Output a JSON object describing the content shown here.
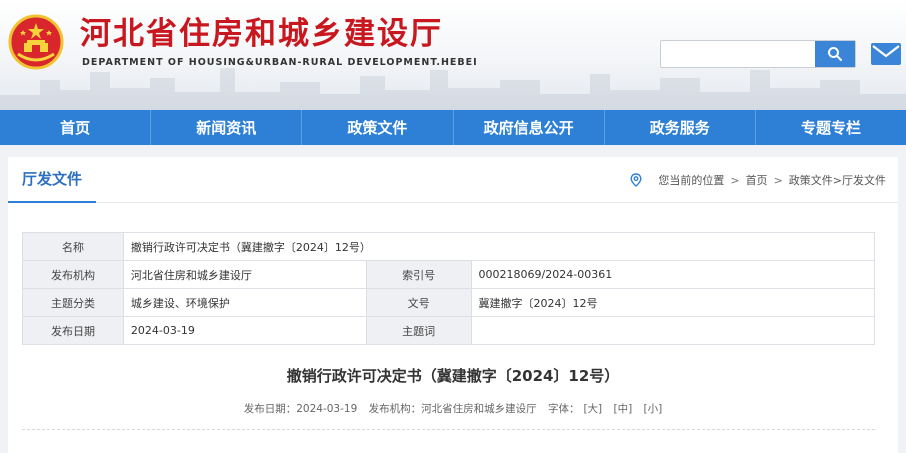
{
  "header": {
    "title": "河北省住房和城乡建设厅",
    "subtitle": "DEPARTMENT OF HOUSING&URBAN-RURAL DEVELOPMENT.HEBEI",
    "search_placeholder": "",
    "brand_color": "#c8171e",
    "accent_color": "#2d80d6"
  },
  "nav": {
    "items": [
      "首页",
      "新闻资讯",
      "政策文件",
      "政府信息公开",
      "政务服务",
      "专题专栏"
    ]
  },
  "section": {
    "title": "厅发文件",
    "breadcrumb": {
      "location_label": "您当前的位置",
      "sep": ">",
      "home": "首页",
      "current": "政策文件>厅发文件"
    }
  },
  "meta": {
    "name_label": "名称",
    "name_value": "撤销行政许可决定书（冀建撤字〔2024〕12号）",
    "issuer_label": "发布机构",
    "issuer_value": "河北省住房和城乡建设厅",
    "index_label": "索引号",
    "index_value": "000218069/2024-00361",
    "topic_label": "主题分类",
    "topic_value": "城乡建设、环境保护",
    "docno_label": "文号",
    "docno_value": "冀建撤字〔2024〕12号",
    "date_label": "发布日期",
    "date_value": "2024-03-19",
    "keywords_label": "主题词",
    "keywords_value": ""
  },
  "article": {
    "title": "撤销行政许可决定书（冀建撤字〔2024〕12号）",
    "date_text": "发布日期：2024-03-19",
    "issuer_text": "发布机构：河北省住房和城乡建设厅",
    "font_label": "字体：",
    "font_large": "[大]",
    "font_medium": "[中]",
    "font_small": "[小]"
  },
  "icons": {
    "emblem": "national-emblem-icon",
    "search": "search-icon",
    "mail": "mail-icon",
    "location": "location-pin-icon"
  }
}
